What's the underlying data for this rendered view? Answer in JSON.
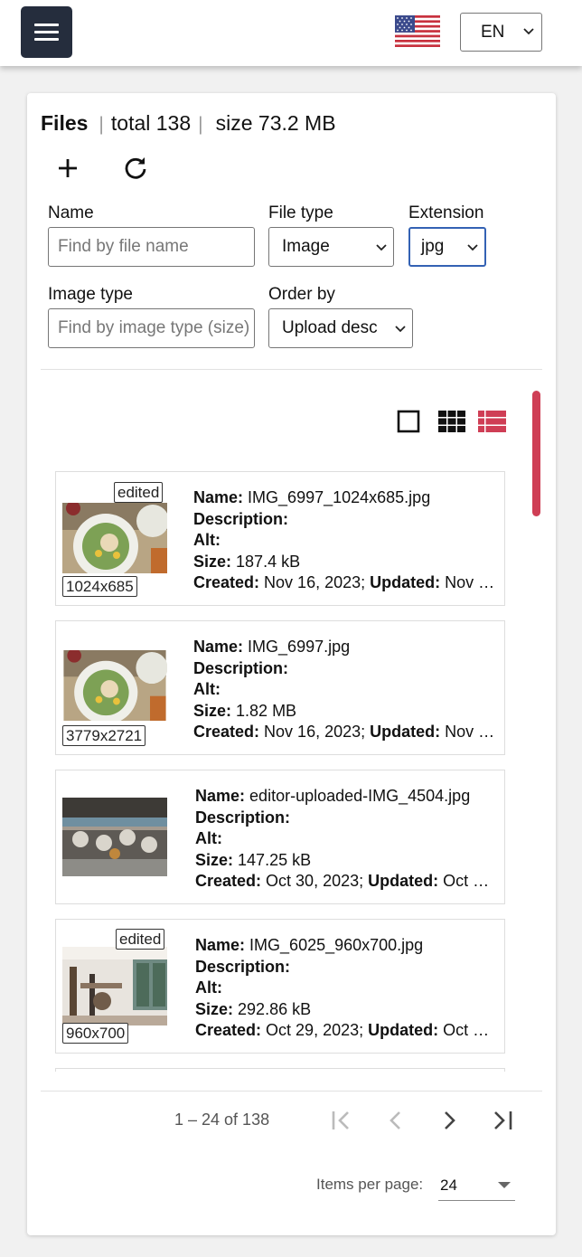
{
  "topbar": {
    "menu_icon": "hamburger-menu-icon",
    "flag_icon": "us-flag-icon",
    "language": "EN"
  },
  "files": {
    "title": "Files",
    "total": "total 138",
    "size": "size 73.2 MB",
    "add_icon": "plus-icon",
    "refresh_icon": "refresh-icon"
  },
  "filters": {
    "name_label": "Name",
    "name_placeholder": "Find by file name",
    "file_type_label": "File type",
    "file_type_value": "Image",
    "extension_label": "Extension",
    "extension_value": "jpg",
    "image_type_label": "Image type",
    "image_type_placeholder": "Find by image type (size)",
    "order_by_label": "Order by",
    "order_by_value": "Upload desc"
  },
  "view_modes": [
    "single-view-icon",
    "grid-view-icon",
    "list-view-icon"
  ],
  "view_mode_active_color": "#cf3e55",
  "items": [
    {
      "edited": "edited",
      "dimensions": "1024x685",
      "name": "IMG_6997_1024x685.jpg",
      "description": "",
      "alt": "",
      "size": "187.4 kB",
      "created": "Nov 16, 2023;",
      "updated": "Nov …"
    },
    {
      "edited": "",
      "dimensions": "3779x2721",
      "name": "IMG_6997.jpg",
      "description": "",
      "alt": "",
      "size": "1.82 MB",
      "created": "Nov 16, 2023;",
      "updated": "Nov …"
    },
    {
      "edited": "",
      "dimensions": "",
      "name": "editor-uploaded-IMG_4504.jpg",
      "description": "",
      "alt": "",
      "size": "147.25 kB",
      "created": "Oct 30, 2023;",
      "updated": "Oct …"
    },
    {
      "edited": "edited",
      "dimensions": "960x700",
      "name": "IMG_6025_960x700.jpg",
      "description": "",
      "alt": "",
      "size": "292.86 kB",
      "created": "Oct 29, 2023;",
      "updated": "Oct …"
    }
  ],
  "labels": {
    "name": "Name:",
    "description": "Description:",
    "alt": "Alt:",
    "size": "Size:",
    "created": "Created:",
    "updated": "Updated:"
  },
  "paginator": {
    "range": "1 – 24 of 138",
    "items_per_page_label": "Items per page:",
    "items_per_page_value": "24"
  }
}
